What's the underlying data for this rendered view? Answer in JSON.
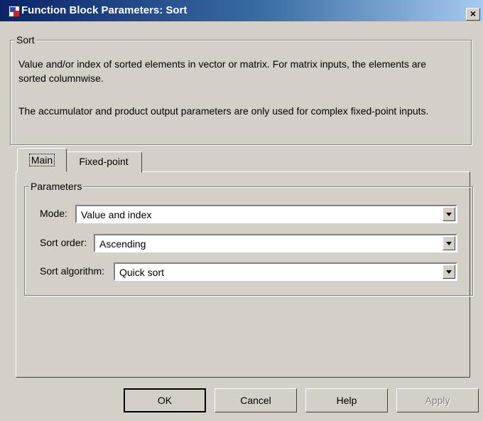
{
  "window": {
    "title": "Function Block Parameters: Sort",
    "close_label": "×"
  },
  "block": {
    "legend": "Sort",
    "description_1": "Value and/or index of sorted elements in vector or matrix.  For matrix inputs, the elements are sorted columnwise.",
    "description_2": "The accumulator and product output parameters are only used for complex fixed-point inputs."
  },
  "tabs": [
    {
      "label": "Main",
      "selected": true
    },
    {
      "label": "Fixed-point",
      "selected": false
    }
  ],
  "parameters": {
    "legend": "Parameters",
    "mode": {
      "label": "Mode:",
      "value": "Value and index"
    },
    "sort_order": {
      "label": "Sort order:",
      "value": "Ascending"
    },
    "sort_algorithm": {
      "label": "Sort algorithm:",
      "value": "Quick sort"
    }
  },
  "buttons": {
    "ok": "OK",
    "cancel": "Cancel",
    "help": "Help",
    "apply": "Apply"
  }
}
